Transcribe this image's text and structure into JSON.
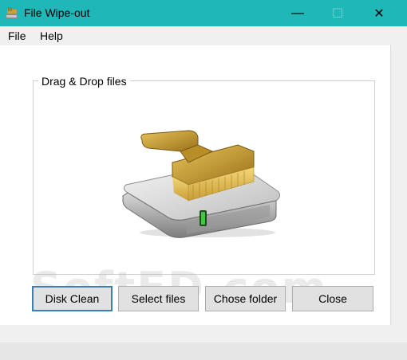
{
  "window": {
    "title": "File Wipe-out",
    "minimize_glyph": "—",
    "maximize_glyph": "☐",
    "close_glyph": "✕"
  },
  "menu": {
    "items": [
      {
        "label": "File"
      },
      {
        "label": "Help"
      }
    ]
  },
  "drop_area": {
    "label": "Drag & Drop files",
    "graphic": "hard-drive-with-brush-icon"
  },
  "buttons": {
    "disk_clean": "Disk Clean",
    "select_files": "Select files",
    "chose_folder": "Chose folder",
    "close": "Close"
  },
  "watermark": "SoftFD.com",
  "colors": {
    "titlebar": "#1fb7b7",
    "focus_border": "#3c7fb1"
  }
}
